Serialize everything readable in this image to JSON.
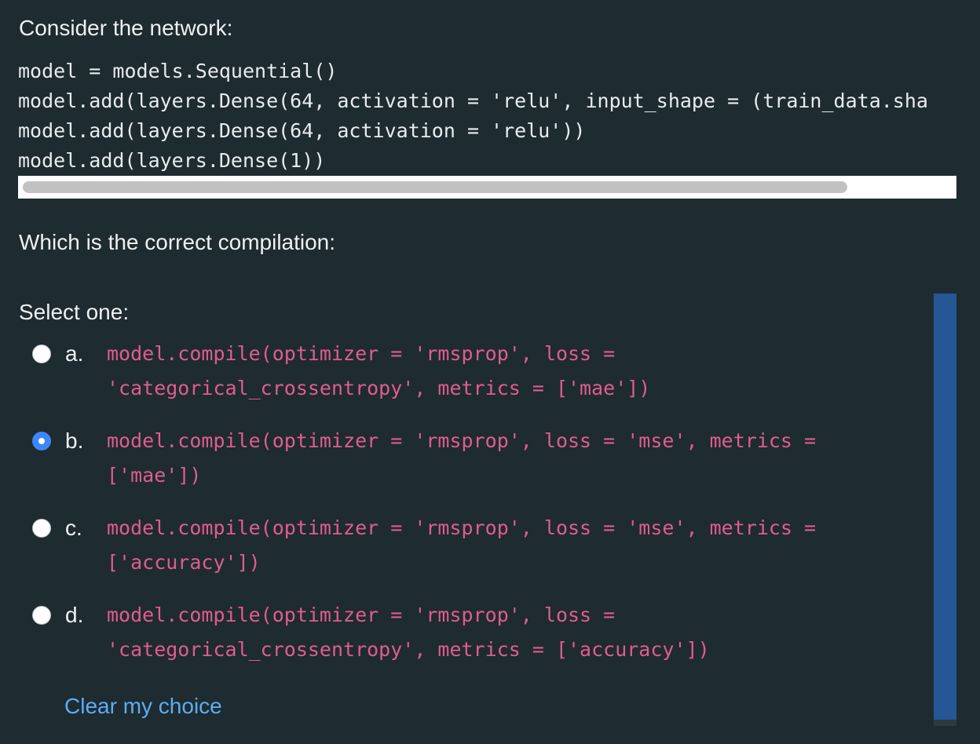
{
  "intro_text": "Consider the network:",
  "code_lines": [
    "model = models.Sequential()",
    "model.add(layers.Dense(64, activation = 'relu', input_shape = (train_data.sha",
    "model.add(layers.Dense(64, activation = 'relu'))",
    "model.add(layers.Dense(1))"
  ],
  "question_text": "Which is the correct compilation:",
  "prompt_text": "Select one:",
  "selected_option": "b",
  "options": [
    {
      "letter": "a.",
      "lines": [
        "model.compile(optimizer = 'rmsprop', loss =",
        "'categorical_crossentropy', metrics = ['mae'])"
      ]
    },
    {
      "letter": "b.",
      "lines": [
        "model.compile(optimizer = 'rmsprop', loss = 'mse', metrics =",
        "['mae'])"
      ]
    },
    {
      "letter": "c.",
      "lines": [
        "model.compile(optimizer = 'rmsprop', loss = 'mse', metrics =",
        "['accuracy'])"
      ]
    },
    {
      "letter": "d.",
      "lines": [
        "model.compile(optimizer = 'rmsprop', loss =",
        "'categorical_crossentropy', metrics = ['accuracy'])"
      ]
    }
  ],
  "clear_label": "Clear my choice",
  "colors": {
    "background": "#1e2b31",
    "code_answer": "#e05c8f",
    "link": "#5aaef2",
    "radio_selected": "#3d86f7",
    "scrollbar_thumb": "#255797"
  }
}
